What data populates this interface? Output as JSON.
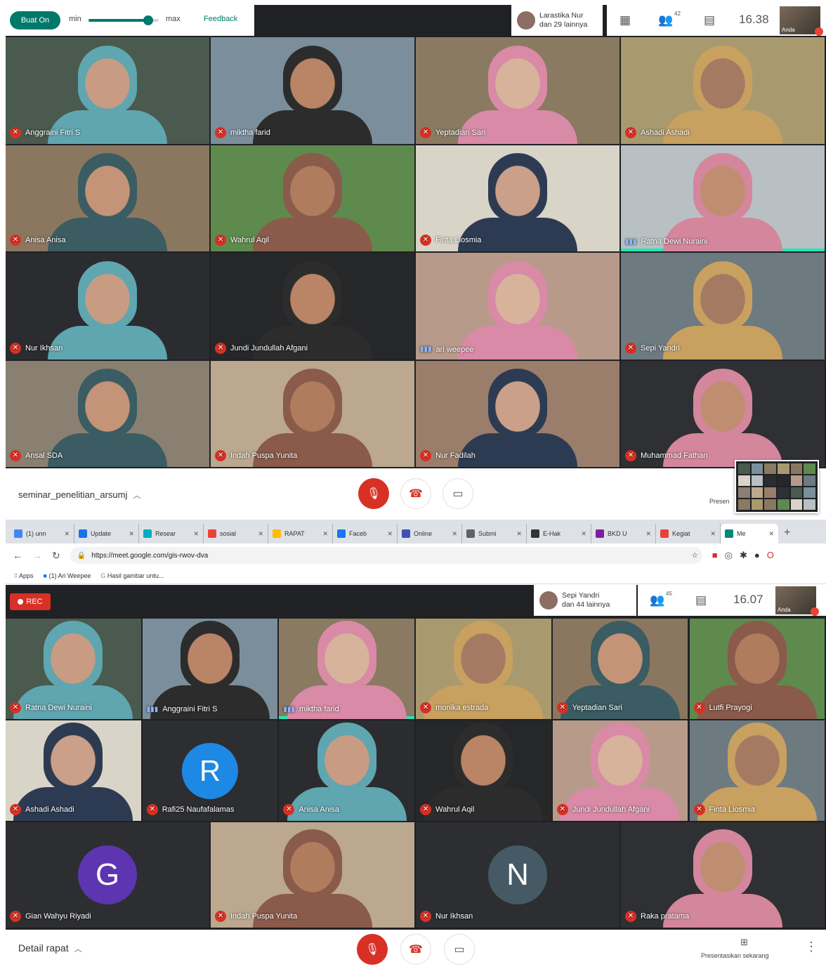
{
  "meeting1": {
    "caption_button": "Buat On",
    "slider_min_label": "min",
    "slider_max_label": "max",
    "slider_level": 0.85,
    "feedback_label": "Feedback",
    "presenter_name": "Larastika Nur",
    "presenter_others": "dan 29 lainnya",
    "participant_count": "42",
    "clock": "16.38",
    "self_label": "Anda",
    "tiles": [
      {
        "name": "Anggraini Fitri S",
        "mic": "off"
      },
      {
        "name": "miktha farid",
        "mic": "off"
      },
      {
        "name": "Yeptadian Sari",
        "mic": "off"
      },
      {
        "name": "Ashadi Ashadi",
        "mic": "off"
      },
      {
        "name": "Anisa Anisa",
        "mic": "off"
      },
      {
        "name": "Wahrul Aqil",
        "mic": "off"
      },
      {
        "name": "Finta Liosmia",
        "mic": "off"
      },
      {
        "name": "Ratna Dewi Nuraini",
        "mic": "on"
      },
      {
        "name": "Nur Ikhsan",
        "mic": "off"
      },
      {
        "name": "Jundi Jundullah Afgani",
        "mic": "off"
      },
      {
        "name": "ari weepee",
        "mic": "on"
      },
      {
        "name": "Sepi Yandri",
        "mic": "off"
      },
      {
        "name": "Ansal SDA",
        "mic": "off"
      },
      {
        "name": "Indah Puspa Yunita",
        "mic": "off"
      },
      {
        "name": "Nur Fadilah",
        "mic": "off"
      },
      {
        "name": "Muhammad Fathan",
        "mic": "off"
      }
    ],
    "meeting_name": "seminar_penelitian_arsumj",
    "present_label": "Presen"
  },
  "browser": {
    "tabs": [
      {
        "label": "(1) unn",
        "color": "#4285f4"
      },
      {
        "label": "Update",
        "color": "#1a73e8"
      },
      {
        "label": "Resear",
        "color": "#00acc1"
      },
      {
        "label": "sosial",
        "color": "#ea4335"
      },
      {
        "label": "RAPAT",
        "color": "#fbbc04"
      },
      {
        "label": "Faceb",
        "color": "#1877f2"
      },
      {
        "label": "Online",
        "color": "#3f51b5"
      },
      {
        "label": "Submi",
        "color": "#5f6368"
      },
      {
        "label": "E-Hak",
        "color": "#333333"
      },
      {
        "label": "BKD U",
        "color": "#7b1fa2"
      },
      {
        "label": "Kegiat",
        "color": "#ea4335"
      },
      {
        "label": "Me",
        "color": "#00897b",
        "active": true
      }
    ],
    "url": "https://meet.google.com/gis-rwov-dva",
    "bookmarks": [
      "Apps",
      "(1) Ari Weepee",
      "Hasil gambar untu..."
    ]
  },
  "meeting2": {
    "rec_label": "REC",
    "presenter_name": "Sepi Yandri",
    "presenter_others": "dan 44 lainnya",
    "participant_count": "45",
    "clock": "16.07",
    "self_label": "Anda",
    "tiles": [
      {
        "name": "Ratna Dewi Nuraini",
        "mic": "off"
      },
      {
        "name": "Anggraini Fitri S",
        "mic": "on"
      },
      {
        "name": "miktha farid",
        "mic": "on"
      },
      {
        "name": "monika estrada",
        "mic": "off"
      },
      {
        "name": "Yeptadian Sari",
        "mic": "off"
      },
      {
        "name": "Lutfi Prayogi",
        "mic": "off"
      },
      {
        "name": "Ashadi Ashadi",
        "mic": "off"
      },
      {
        "name": "Rafi25 Naufafalamas",
        "mic": "off",
        "letter": "R",
        "color": "#1e88e5"
      },
      {
        "name": "Anisa Anisa",
        "mic": "off"
      },
      {
        "name": "Wahrul Aqil",
        "mic": "off"
      },
      {
        "name": "Jundi Jundullah Afgani",
        "mic": "off"
      },
      {
        "name": "Finta Liosmia",
        "mic": "off"
      },
      {
        "name": "Gian Wahyu Riyadi",
        "mic": "off",
        "letter": "G",
        "color": "#5e35b1"
      },
      {
        "name": "Indah Puspa Yunita",
        "mic": "off"
      },
      {
        "name": "Nur Ikhsan",
        "mic": "off",
        "letter": "N",
        "color": "#455a64"
      },
      {
        "name": "Raka pratama",
        "mic": "off"
      }
    ],
    "meeting_name": "Detail rapat",
    "present_label": "Presentasikan sekarang"
  }
}
